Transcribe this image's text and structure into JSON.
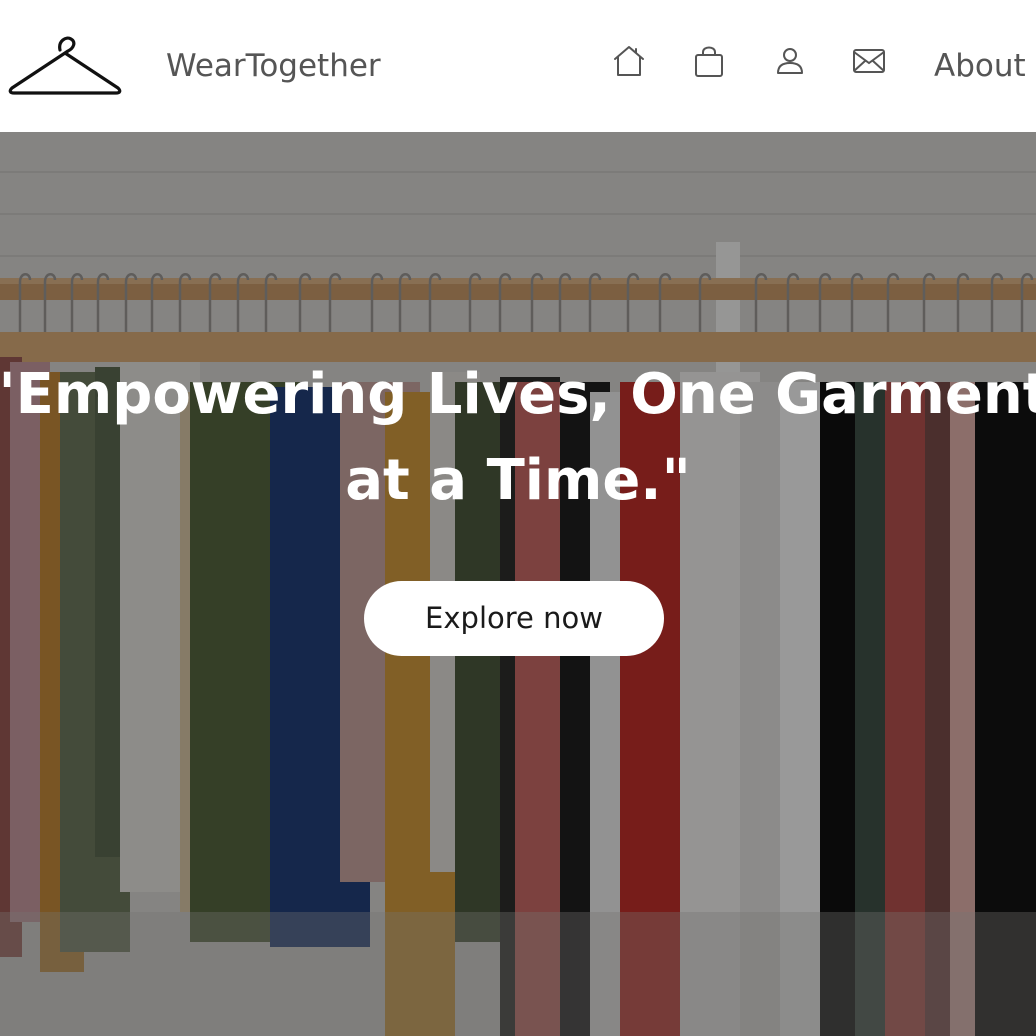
{
  "header": {
    "brand_name": "WearTogether",
    "logo_icon": "clothes-hanger-icon",
    "nav_icons": [
      "home-icon",
      "shopping-bag-icon",
      "user-icon",
      "mail-icon"
    ],
    "about_label": "About"
  },
  "hero": {
    "tagline": "\"Empowering Lives, One Garment at a Time.\"",
    "cta_label": "Explore now",
    "background_image": "clothing rack with hanging garments"
  },
  "colors": {
    "nav_text": "#555555",
    "hero_text": "#ffffff",
    "button_bg": "#ffffff",
    "button_text": "#1a1a1a"
  }
}
